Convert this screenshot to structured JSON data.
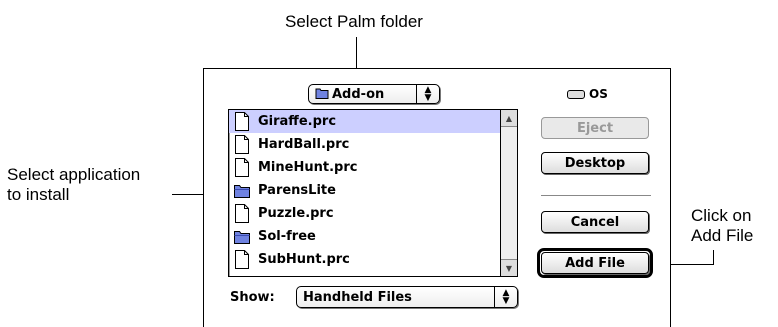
{
  "callouts": {
    "top": "Select Palm folder",
    "left_line1": "Select application",
    "left_line2": "to install",
    "right_line1": "Click on",
    "right_line2": "Add File"
  },
  "folder_popup": {
    "label": "Add-on"
  },
  "volume": {
    "name": "OS",
    "icon": "hard-disk-icon"
  },
  "file_list": {
    "items": [
      {
        "name": "Giraffe.prc",
        "icon": "document-icon",
        "selected": true
      },
      {
        "name": "HardBall.prc",
        "icon": "document-icon",
        "selected": false
      },
      {
        "name": "MineHunt.prc",
        "icon": "document-icon",
        "selected": false
      },
      {
        "name": "ParensLite",
        "icon": "folder-icon",
        "selected": false
      },
      {
        "name": "Puzzle.prc",
        "icon": "document-icon",
        "selected": false
      },
      {
        "name": "Sol-free",
        "icon": "folder-icon",
        "selected": false
      },
      {
        "name": "SubHunt.prc",
        "icon": "document-icon",
        "selected": false
      }
    ]
  },
  "buttons": {
    "eject": "Eject",
    "desktop": "Desktop",
    "cancel": "Cancel",
    "add_file": "Add File"
  },
  "show": {
    "label": "Show:",
    "value": "Handheld Files"
  },
  "colors": {
    "selection": "#cccfff",
    "folder": "#5b6fd6"
  }
}
